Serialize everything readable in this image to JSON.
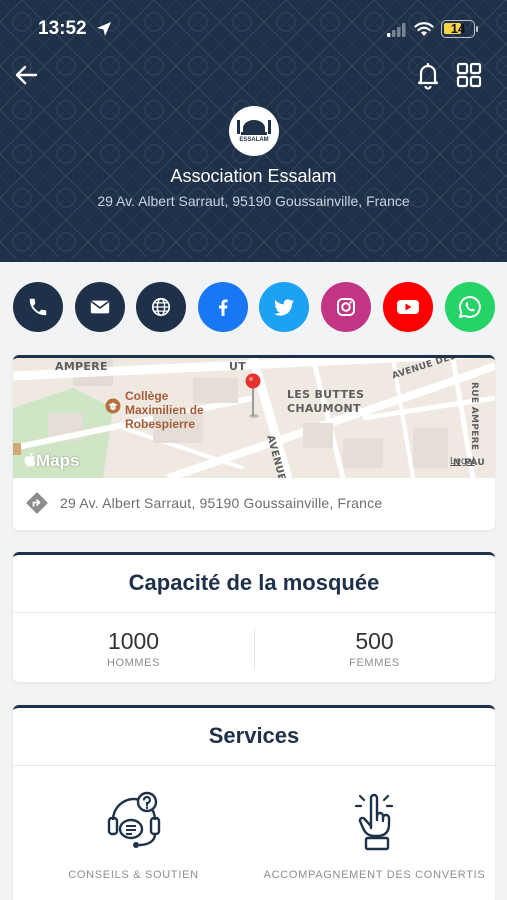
{
  "status_bar": {
    "time": "13:52",
    "battery_level": "14",
    "icons": [
      "location-arrow-icon",
      "cell-signal-icon",
      "wifi-icon",
      "battery-icon"
    ]
  },
  "nav": {
    "icons": [
      "back-arrow-icon",
      "bell-icon",
      "grid-icon"
    ]
  },
  "profile": {
    "logo_text": "ESSALAM",
    "name": "Association Essalam",
    "address": "29 Av. Albert Sarraut, 95190 Goussainville, France"
  },
  "contacts": [
    {
      "name": "phone",
      "icon": "phone-icon",
      "color": "#1e3148"
    },
    {
      "name": "email",
      "icon": "mail-icon",
      "color": "#1e3148"
    },
    {
      "name": "website",
      "icon": "globe-icon",
      "color": "#1e3148"
    },
    {
      "name": "facebook",
      "icon": "facebook-icon",
      "color": "#1877f2"
    },
    {
      "name": "twitter",
      "icon": "twitter-icon",
      "color": "#1da1f2"
    },
    {
      "name": "instagram",
      "icon": "instagram-icon",
      "color": "#c13584"
    },
    {
      "name": "youtube",
      "icon": "youtube-icon",
      "color": "#ff0000"
    },
    {
      "name": "whatsapp",
      "icon": "whatsapp-icon",
      "color": "#25d366"
    }
  ],
  "map": {
    "labels": {
      "ampere": "AMPERE",
      "buttes_1": "LES BUTTES",
      "buttes_2": "CHAUMONT",
      "avenue_des": "AVENUE DES T",
      "rue_ampere": "RUE AMPERE",
      "avenue": "AVENUE",
      "ut": "UT",
      "pau": "N PAU"
    },
    "poi_lines": [
      "Collège",
      "Maximilien de",
      "Robespierre"
    ],
    "brand": "Maps",
    "legal": "Legal",
    "address": "29 Av. Albert Sarraut, 95190 Goussainville, France"
  },
  "capacity": {
    "title": "Capacité de la mosquée",
    "men": {
      "value": "1000",
      "label": "HOMMES"
    },
    "women": {
      "value": "500",
      "label": "FEMMES"
    }
  },
  "services": {
    "title": "Services",
    "items": [
      {
        "label": "CONSEILS & SOUTIEN",
        "icon": "support-headset-icon"
      },
      {
        "label": "ACCOMPAGNEMENT DES CONVERTIS",
        "icon": "raised-hand-icon"
      }
    ]
  },
  "colors": {
    "header_bg": "#1e3148",
    "accent": "#1e3148",
    "page_bg": "#f2f3f5"
  }
}
